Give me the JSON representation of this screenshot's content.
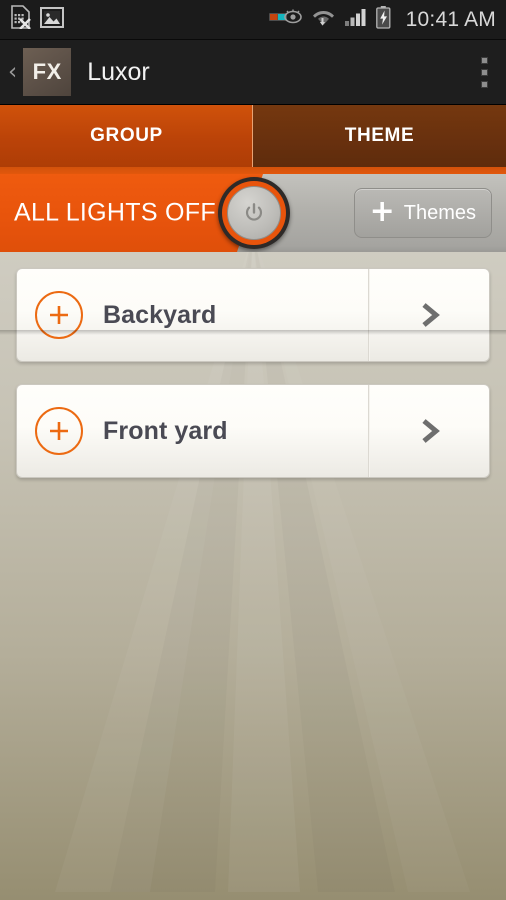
{
  "status_bar": {
    "time": "10:41 AM",
    "left_icons": [
      {
        "name": "sim-card-removed-icon"
      },
      {
        "name": "gallery-image-icon"
      }
    ],
    "right_icons": [
      {
        "name": "smart-stay-eye-icon"
      },
      {
        "name": "wifi-signal-icon"
      },
      {
        "name": "cellular-signal-icon"
      },
      {
        "name": "battery-charging-icon"
      }
    ]
  },
  "action_bar": {
    "back_label": "‹",
    "logo_text": "FX",
    "title": "Luxor",
    "overflow_label": "More options"
  },
  "tabs": [
    {
      "label": "GROUP",
      "active": true
    },
    {
      "label": "THEME",
      "active": false
    }
  ],
  "control_bar": {
    "toggle_label": "ALL LIGHTS OFF",
    "toggle_state": "off",
    "power_icon": "power-icon",
    "themes_button": {
      "plus": "+",
      "label": "Themes"
    }
  },
  "groups": [
    {
      "name": "Backyard",
      "add_icon": "plus-circle-icon",
      "chevron": "chevron-right-icon"
    },
    {
      "name": "Front yard",
      "add_icon": "plus-circle-icon",
      "chevron": "chevron-right-icon"
    }
  ],
  "colors": {
    "accent_orange": "#e8540c",
    "tab_active": "#bb4308",
    "tab_inactive": "#68300e",
    "status_bar_bg": "#1b1b1b",
    "action_bar_bg": "#1e1e1e",
    "content_bg_top": "#cfccc1",
    "content_bg_bottom": "#968e71",
    "card_text": "#4a4a54"
  }
}
